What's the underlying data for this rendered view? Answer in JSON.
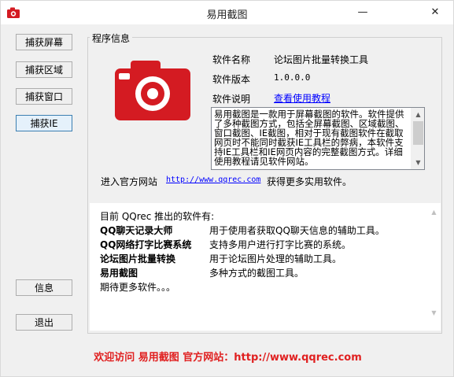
{
  "window": {
    "title": "易用截图",
    "minimize_glyph": "—",
    "close_glyph": "✕"
  },
  "sidebar": {
    "buttons": [
      "捕获屏幕",
      "捕获区域",
      "捕获窗口",
      "捕获IE"
    ],
    "info_label": "信息",
    "exit_label": "退出"
  },
  "program_info": {
    "group_title": "程序信息",
    "name_label": "软件名称",
    "name_value": "论坛图片批量转换工具",
    "version_label": "软件版本",
    "version_value": "1.0.0.0",
    "desc_label": "软件说明",
    "desc_link": "查看使用教程",
    "description": "易用截图是一款用于屏幕截图的软件。软件提供了多种截图方式，包括全屏幕截图、区域截图、窗口截图、IE截图，相对于现有截图软件在截取网页时不能同时截获IE工具栏的弊病，本软件支持IE工具栏和IE网页内容的完整截图方式。详细使用教程请见软件网站。",
    "site_prefix": "进入官方网站",
    "site_url": "http://www.qqrec.com",
    "site_suffix": "获得更多实用软件。"
  },
  "products": {
    "intro": "目前 QQrec 推出的软件有:",
    "items": [
      {
        "name": "QQ聊天记录大师",
        "desc": "用于使用者获取QQ聊天信息的辅助工具。"
      },
      {
        "name": "QQ网络打字比赛系统",
        "desc": "支持多用户进行打字比赛的系统。"
      },
      {
        "name": "论坛图片批量转换",
        "desc": "用于论坛图片处理的辅助工具。"
      },
      {
        "name": "易用截图",
        "desc": "多种方式的截图工具。"
      }
    ],
    "more": "期待更多软件。。。"
  },
  "footer": {
    "text": "欢迎访问 易用截图 官方网站：http://www.qqrec.com"
  },
  "colors": {
    "camera_red": "#d41b22",
    "footer_red": "#e02020",
    "link_blue": "#0000ff"
  },
  "icons": {
    "app": "camera-icon",
    "logo": "camera-icon",
    "scroll_up": "chevron-up-icon",
    "scroll_down": "chevron-down-icon"
  }
}
